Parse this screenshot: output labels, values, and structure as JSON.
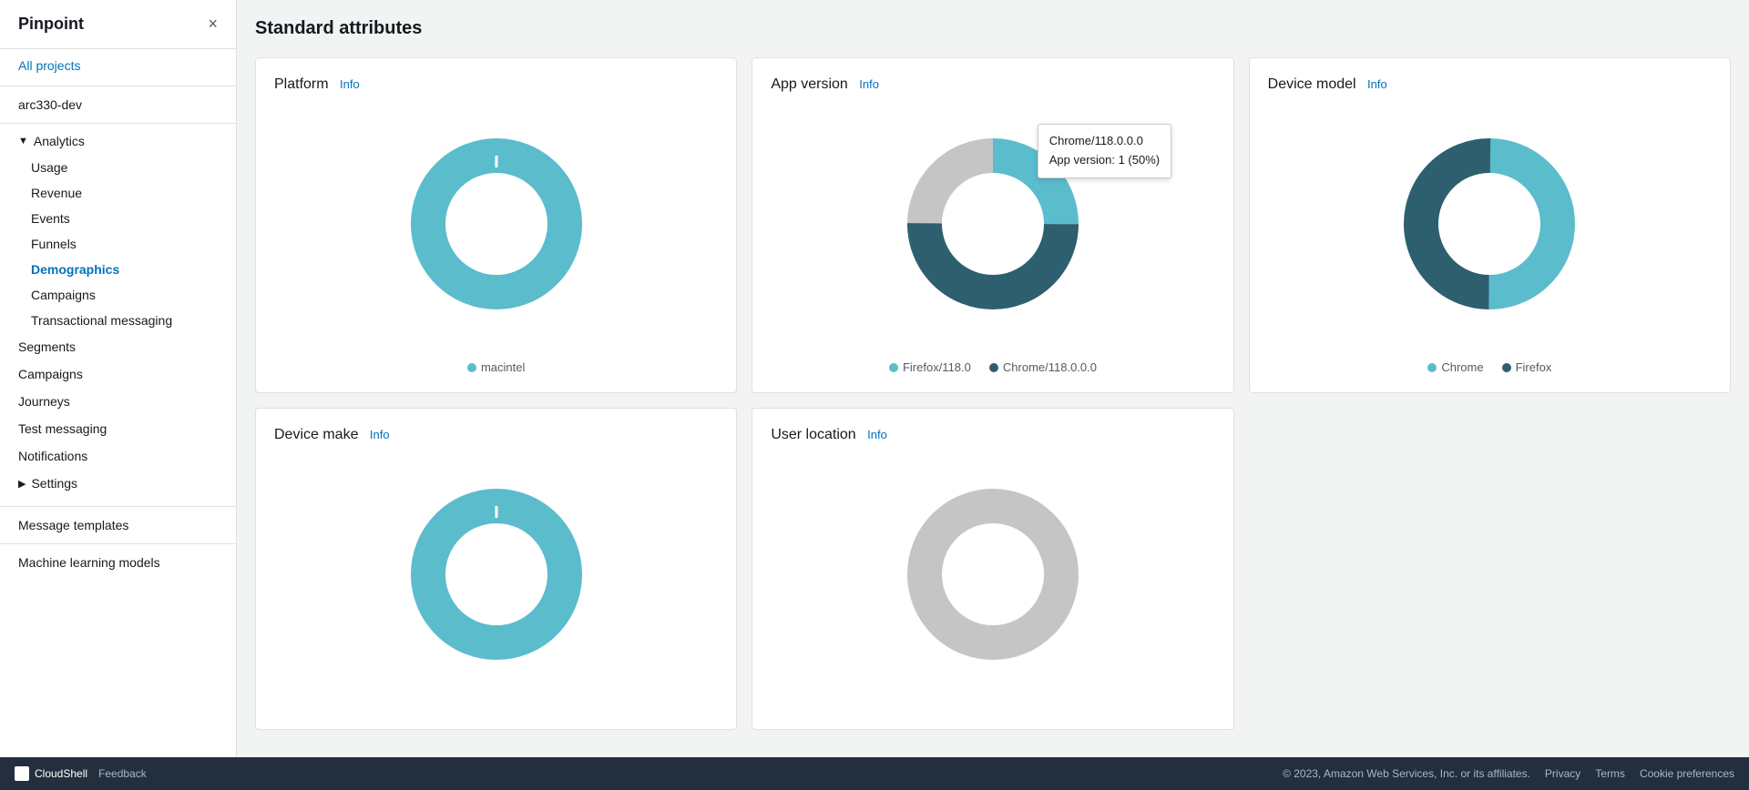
{
  "app": {
    "title": "Pinpoint",
    "close_icon": "×"
  },
  "sidebar": {
    "all_projects": "All projects",
    "project_name": "arc330-dev",
    "nav": [
      {
        "label": "Analytics",
        "type": "parent-expanded",
        "chevron": "▼"
      },
      {
        "label": "Usage",
        "type": "sub"
      },
      {
        "label": "Revenue",
        "type": "sub"
      },
      {
        "label": "Events",
        "type": "sub"
      },
      {
        "label": "Funnels",
        "type": "sub"
      },
      {
        "label": "Demographics",
        "type": "sub",
        "active": true
      },
      {
        "label": "Campaigns",
        "type": "sub"
      },
      {
        "label": "Transactional messaging",
        "type": "sub"
      },
      {
        "label": "Segments",
        "type": "top"
      },
      {
        "label": "Campaigns",
        "type": "top"
      },
      {
        "label": "Journeys",
        "type": "top"
      },
      {
        "label": "Test messaging",
        "type": "top"
      },
      {
        "label": "Notifications",
        "type": "top"
      },
      {
        "label": "Settings",
        "type": "parent-collapsed",
        "chevron": "▶"
      }
    ],
    "bottom": [
      {
        "label": "Message templates"
      },
      {
        "label": "Machine learning models"
      }
    ]
  },
  "main": {
    "page_title": "Standard attributes",
    "charts": [
      {
        "id": "platform",
        "title": "Platform",
        "info": "Info",
        "legend": [
          {
            "label": "macintel",
            "color": "#5bbccc"
          }
        ],
        "donut": {
          "segments": [
            {
              "color": "#5bbccc",
              "pct": 100
            }
          ]
        },
        "tooltip": null
      },
      {
        "id": "app-version",
        "title": "App version",
        "info": "Info",
        "legend": [
          {
            "label": "Firefox/118.0",
            "color": "#5bbccc"
          },
          {
            "label": "Chrome/118.0.0.0",
            "color": "#2e5f6e"
          }
        ],
        "donut": {
          "segments": [
            {
              "color": "#c5c5c5",
              "pct": 25
            },
            {
              "color": "#5bbccc",
              "pct": 25
            },
            {
              "color": "#2e5f6e",
              "pct": 50
            }
          ]
        },
        "tooltip": {
          "line1": "Chrome/118.0.0.0",
          "line2": "App version: 1 (50%)"
        }
      },
      {
        "id": "device-model",
        "title": "Device model",
        "info": "Info",
        "legend": [
          {
            "label": "Chrome",
            "color": "#5bbccc"
          },
          {
            "label": "Firefox",
            "color": "#2e5f6e"
          }
        ],
        "donut": {
          "segments": [
            {
              "color": "#5bbccc",
              "pct": 50
            },
            {
              "color": "#2e5f6e",
              "pct": 50
            }
          ]
        },
        "tooltip": null
      },
      {
        "id": "device-make",
        "title": "Device make",
        "info": "Info",
        "legend": [],
        "donut": {
          "segments": [
            {
              "color": "#5bbccc",
              "pct": 100
            }
          ]
        },
        "tooltip": null
      },
      {
        "id": "user-location",
        "title": "User location",
        "info": "Info",
        "legend": [],
        "donut": {
          "segments": [
            {
              "color": "#c5c5c5",
              "pct": 100
            }
          ]
        },
        "tooltip": null
      }
    ]
  },
  "footer": {
    "copyright": "© 2023, Amazon Web Services, Inc. or its affiliates.",
    "privacy": "Privacy",
    "terms": "Terms",
    "cookie": "Cookie preferences",
    "cloudshell": "CloudShell",
    "feedback": "Feedback"
  }
}
